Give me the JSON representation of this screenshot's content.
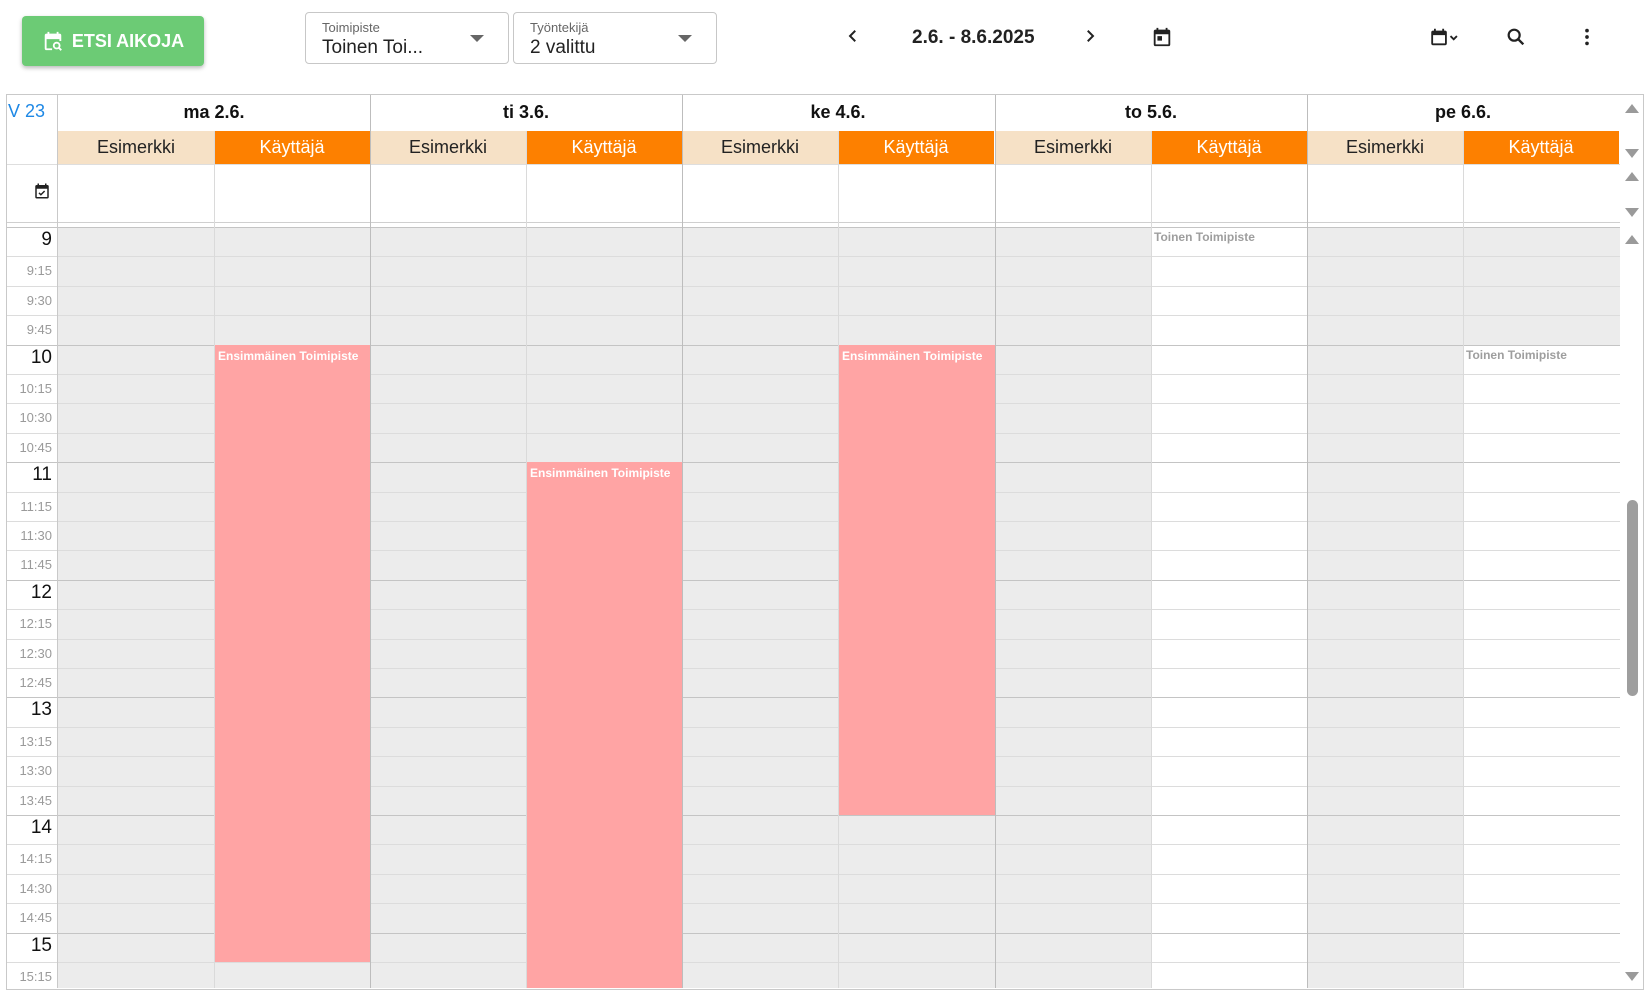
{
  "toolbar": {
    "search_slots_label": "ETSI AIKOJA",
    "office": {
      "label": "Toimipiste",
      "value": "Toinen Toi..."
    },
    "employee": {
      "label": "Työntekijä",
      "value": "2 valittu"
    },
    "date_range": "2.6. - 8.6.2025"
  },
  "calendar": {
    "week_label": "V 23",
    "days": [
      {
        "name": "ma 2.6.",
        "resources": [
          "Esimerkki",
          "Käyttäjä"
        ]
      },
      {
        "name": "ti 3.6.",
        "resources": [
          "Esimerkki",
          "Käyttäjä"
        ]
      },
      {
        "name": "ke 4.6.",
        "resources": [
          "Esimerkki",
          "Käyttäjä"
        ]
      },
      {
        "name": "to 5.6.",
        "resources": [
          "Esimerkki",
          "Käyttäjä"
        ]
      },
      {
        "name": "pe 6.6.",
        "resources": [
          "Esimerkki",
          "Käyttäjä"
        ]
      }
    ],
    "time_labels": [
      "9",
      "9:15",
      "9:30",
      "9:45",
      "10",
      "10:15",
      "10:30",
      "10:45",
      "11",
      "11:15",
      "11:30",
      "11:45",
      "12",
      "12:15",
      "12:30",
      "12:45",
      "13",
      "13:15",
      "13:30",
      "13:45",
      "14",
      "14:15",
      "14:30",
      "14:45",
      "15",
      "15:15"
    ],
    "events": [
      {
        "day": 0,
        "resource": 1,
        "start": "10:00",
        "end": "15:15",
        "title": "Ensimmäinen Toimipiste"
      },
      {
        "day": 1,
        "resource": 1,
        "start": "11:00",
        "end": "15:30",
        "title": "Ensimmäinen Toimipiste"
      },
      {
        "day": 2,
        "resource": 1,
        "start": "10:00",
        "end": "14:00",
        "title": "Ensimmäinen Toimipiste"
      }
    ],
    "availability": [
      {
        "day": 3,
        "resource": 1,
        "start": "9:00",
        "label": "Toinen Toimipiste"
      },
      {
        "day": 4,
        "resource": 1,
        "start": "10:00",
        "label": "Toinen Toimipiste"
      }
    ],
    "colors": {
      "event": "#ffa4a4",
      "resource_esimerkki": "#f6e1c6",
      "resource_kayttaja": "#fd8000",
      "closed_slot": "#ececec",
      "primary_button": "#6ccb75",
      "week_label": "#1e88e5"
    },
    "icons": [
      "calendar-search-icon",
      "chevron-left-icon",
      "chevron-right-icon",
      "calendar-icon",
      "calendar-view-icon",
      "search-icon",
      "more-vert-icon",
      "event-available-icon"
    ]
  }
}
